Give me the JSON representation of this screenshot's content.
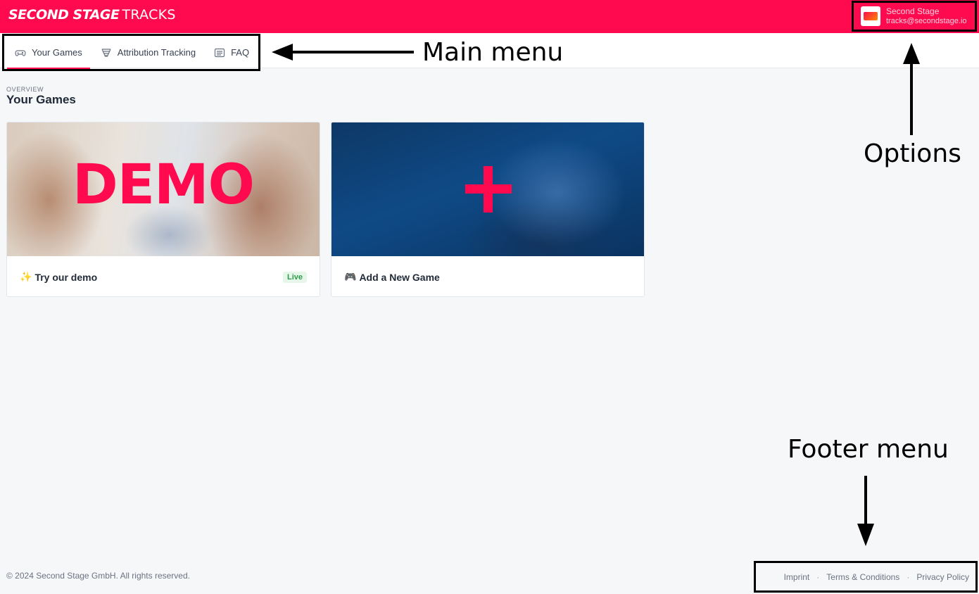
{
  "header": {
    "brand_bold": "SECOND STAGE",
    "brand_light": "TRACKS",
    "account_name": "Second Stage",
    "account_email": "tracks@secondstage.io"
  },
  "nav": {
    "items": [
      {
        "label": "Your Games",
        "icon": "gamepad-icon",
        "active": true
      },
      {
        "label": "Attribution Tracking",
        "icon": "funnel-icon",
        "active": false
      },
      {
        "label": "FAQ",
        "icon": "list-icon",
        "active": false
      }
    ]
  },
  "annotations": {
    "main_menu": "Main menu",
    "options": "Options",
    "footer_menu": "Footer menu"
  },
  "main": {
    "overline": "OVERVIEW",
    "title": "Your Games",
    "cards": [
      {
        "image_text": "DEMO",
        "emoji": "✨",
        "label": "Try our demo",
        "badge": "Live"
      },
      {
        "image_text": "+",
        "emoji": "🎮",
        "label": "Add a New Game"
      }
    ]
  },
  "footer": {
    "copyright": "© 2024 Second Stage GmbH. All rights reserved.",
    "links": [
      "Imprint",
      "Terms & Conditions",
      "Privacy Policy"
    ],
    "separator": "·"
  },
  "colors": {
    "brand": "#ff0a4f",
    "background": "#f6f7f9",
    "live_badge": "#2e9a4a"
  }
}
